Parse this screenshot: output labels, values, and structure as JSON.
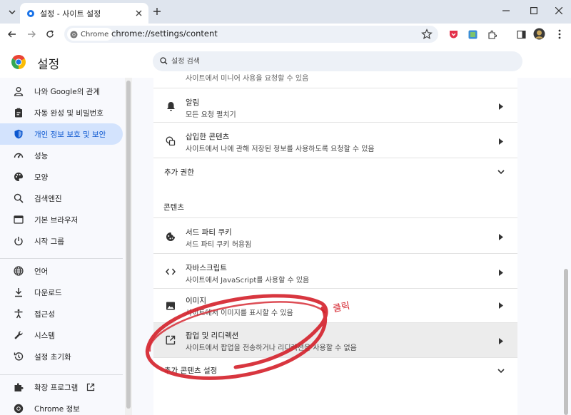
{
  "tabbar": {
    "tab_title": "설정 - 사이트 설정"
  },
  "toolbar": {
    "chip_label": "Chrome",
    "url": "chrome://settings/content"
  },
  "header": {
    "title": "설정",
    "search_placeholder": "설정 검색"
  },
  "sidebar": {
    "items": [
      {
        "label": "나와 Google의 관계",
        "icon": "person-icon"
      },
      {
        "label": "자동 완성 및 비밀번호",
        "icon": "clipboard-icon"
      },
      {
        "label": "개인 정보 보호 및 보안",
        "icon": "shield-icon",
        "active": true
      },
      {
        "label": "성능",
        "icon": "speedometer-icon"
      },
      {
        "label": "모양",
        "icon": "palette-icon"
      },
      {
        "label": "검색엔진",
        "icon": "search-icon"
      },
      {
        "label": "기본 브라우저",
        "icon": "browser-icon"
      },
      {
        "label": "시작 그룹",
        "icon": "power-icon"
      },
      {
        "label": "언어",
        "icon": "globe-icon"
      },
      {
        "label": "다운로드",
        "icon": "download-icon"
      },
      {
        "label": "접근성",
        "icon": "accessibility-icon"
      },
      {
        "label": "시스템",
        "icon": "wrench-icon"
      },
      {
        "label": "설정 초기화",
        "icon": "reset-icon"
      },
      {
        "label": "확장 프로그램",
        "icon": "puzzle-icon"
      },
      {
        "label": "Chrome 정보",
        "icon": "chrome-icon"
      }
    ]
  },
  "main": {
    "partial_top": "사이트에서 미니어 사용을 요청할 수 있음",
    "rows": [
      {
        "title": "알림",
        "sub": "모든 요청 펼치기",
        "icon": "bell-icon"
      },
      {
        "title": "삽입한 콘텐츠",
        "sub": "사이트에서 나에 관해 저장된 정보를 사용하도록 요청할 수 있음",
        "icon": "embedded-content-icon"
      }
    ],
    "more_permissions": "추가 권한",
    "content_heading": "콘텐츠",
    "content_rows": [
      {
        "title": "서드 파티 쿠키",
        "sub": "서드 파티 쿠키 허용됨",
        "icon": "cookie-icon"
      },
      {
        "title": "자바스크립트",
        "sub": "사이트에서 JavaScript를 사용할 수 있음",
        "icon": "code-icon"
      },
      {
        "title": "이미지",
        "sub": "사이트에서 이미지를 표시할 수 있음",
        "icon": "image-icon"
      },
      {
        "title": "팝업 및 리디렉션",
        "sub": "사이트에서 팝업을 전송하거나 리디렉션을 사용할 수 없음",
        "icon": "popup-icon"
      }
    ],
    "more_content": "추가 콘텐츠 설정"
  },
  "annotation": {
    "text": "클릭",
    "color": "#d4202a"
  }
}
